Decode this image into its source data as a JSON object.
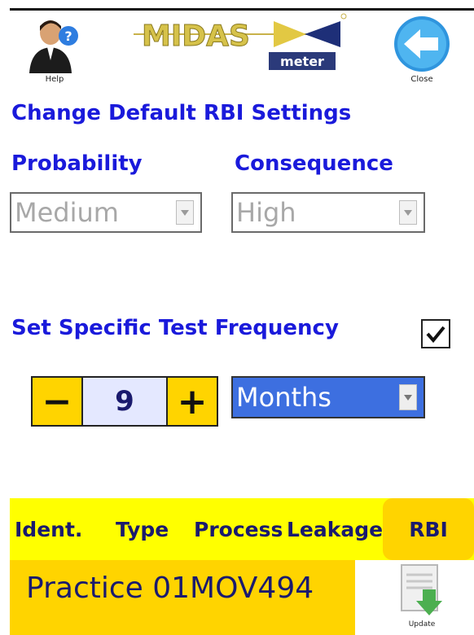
{
  "header": {
    "help_label": "Help",
    "logo_text": "MIDAS",
    "logo_subtext": "meter",
    "close_label": "Close"
  },
  "rbi": {
    "title": "Change Default RBI Settings",
    "probability_label": "Probability",
    "probability_value": "Medium",
    "consequence_label": "Consequence",
    "consequence_value": "High"
  },
  "frequency": {
    "label": "Set Specific Test Frequency",
    "checked": true,
    "decrement": "−",
    "value": "9",
    "increment": "+",
    "unit": "Months"
  },
  "table": {
    "columns": [
      "Ident.",
      "Type",
      "Process",
      "Leakage",
      "RBI"
    ],
    "row_text": "Practice 01MOV494",
    "update_label": "Update"
  },
  "colors": {
    "accent_blue": "#1a1adb",
    "yellow": "#ffff00",
    "gold": "#ffd400",
    "selected_blue": "#3d6fe0"
  }
}
